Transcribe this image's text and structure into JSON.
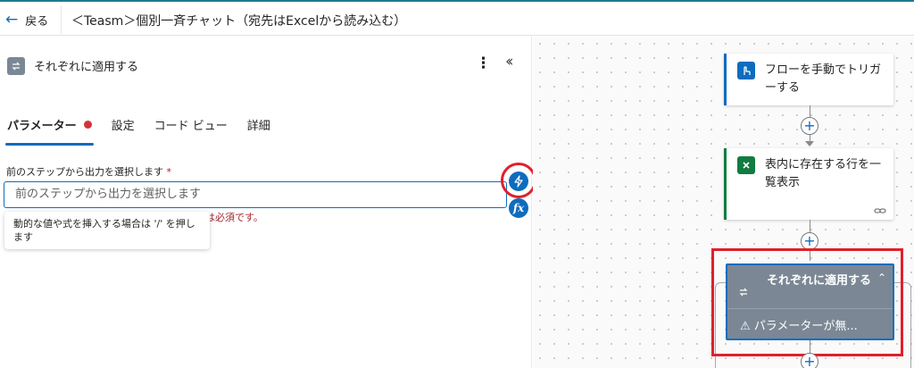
{
  "topbar": {
    "back_label": "戻る",
    "flow_title": "＜Teasm＞個別一斉チャット（宛先はExcelから読み込む）"
  },
  "panel": {
    "title": "それぞれに適用する",
    "more_icon": "more-vertical-icon",
    "collapse_icon": "double-chevron-left-icon",
    "tabs": [
      {
        "label": "パラメーター",
        "active": true,
        "has_error": true
      },
      {
        "label": "設定"
      },
      {
        "label": "コード ビュー"
      },
      {
        "label": "詳細"
      }
    ],
    "field": {
      "label": "前のステップから出力を選択します",
      "required_mark": "*",
      "placeholder": "前のステップから出力を選択します",
      "value": ""
    },
    "error_partial": "は必須です。",
    "tooltip": "動的な値や式を挿入する場合は '/' を押します",
    "dynamic_button_icon": "lightning-icon",
    "fx_label": "fx"
  },
  "canvas": {
    "nodes": [
      {
        "title": "フローを手動でトリガーする",
        "icon": "hand-touch-icon",
        "accent": "#0f6cbd"
      },
      {
        "title": "表内に存在する行を一覧表示",
        "icon": "excel-icon",
        "accent": "#107c41",
        "footer_icon": "link-icon"
      },
      {
        "title": "それぞれに適用する",
        "icon": "loop-icon",
        "warning": "パラメーターが無..."
      }
    ]
  },
  "colors": {
    "accent": "#0f6cbd",
    "excel": "#107c41",
    "error": "#a4262c",
    "highlight": "#e0202a",
    "apply_card": "#7b8794"
  }
}
